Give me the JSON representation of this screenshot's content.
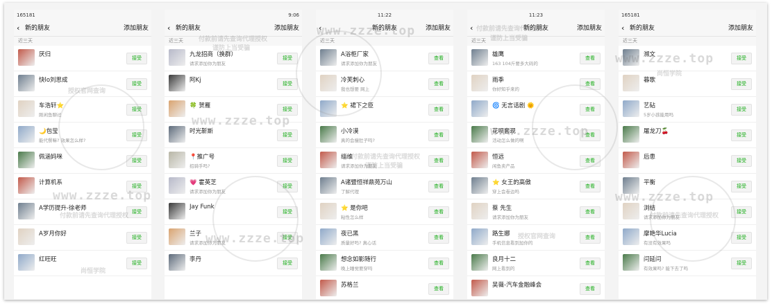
{
  "screens": [
    {
      "status": {
        "left": "165181",
        "center": "",
        "right": ""
      },
      "nav": {
        "title": "新的朋友",
        "add": "添加朋友",
        "centered": false
      },
      "section": "近三天",
      "rows": [
        {
          "name": "厌归",
          "msg": "",
          "btn": "接受"
        },
        {
          "name": "快lo刘思成",
          "msg": "",
          "btn": "接受"
        },
        {
          "name": "车浩轩⭐",
          "msg": "刚闲鱼聊过",
          "btn": "接受"
        },
        {
          "name": "🌙包莹",
          "msg": "能代餐嘛? 效果怎么样?",
          "btn": "接受"
        },
        {
          "name": "佩涵妈咪",
          "msg": "",
          "btn": "接受"
        },
        {
          "name": "计算机系",
          "msg": "",
          "btn": "接受"
        },
        {
          "name": "A学历提升-徐老师",
          "msg": "",
          "btn": "接受"
        },
        {
          "name": "A岁月你好",
          "msg": "",
          "btn": "接受"
        },
        {
          "name": "红旺旺",
          "msg": "",
          "btn": "接受"
        }
      ]
    },
    {
      "status": {
        "left": "",
        "center": "",
        "right": "9:06"
      },
      "nav": {
        "title": "新的朋友",
        "add": "添加朋友",
        "centered": false
      },
      "section": "近三天",
      "rows": [
        {
          "name": "九龙招商（换群）",
          "msg": "请求添加你为朋友",
          "btn": "接受"
        },
        {
          "name": "阿Kj",
          "msg": "",
          "btn": "接受"
        },
        {
          "name": "🍀 贺雁",
          "msg": "",
          "btn": "接受"
        },
        {
          "name": "时光靳斯",
          "msg": "",
          "btn": "接受"
        },
        {
          "name": "📍推广号",
          "msg": "招骑手吗?",
          "btn": "接受"
        },
        {
          "name": "💗 霍英芝",
          "msg": "请求添加你为朋友",
          "btn": "接受"
        },
        {
          "name": "Jay Funk",
          "msg": "",
          "btn": "接受"
        },
        {
          "name": "兰子",
          "msg": "请求添加你为朋友",
          "btn": "接受"
        },
        {
          "name": "李丹",
          "msg": "",
          "btn": "接受"
        }
      ]
    },
    {
      "status": {
        "left": "",
        "center": "11:22",
        "right": ""
      },
      "nav": {
        "title": "新的朋友",
        "add": "添加朋友",
        "centered": true
      },
      "section": "近三天",
      "rows": [
        {
          "name": "A浴柜厂家",
          "msg": "请求添加你为朋友",
          "btn": "查看"
        },
        {
          "name": "冷芙刺心",
          "msg": "我也想要 网上",
          "btn": "查看"
        },
        {
          "name": "⭐ 裙下之臣",
          "msg": "",
          "btn": "查看"
        },
        {
          "name": "小冷漠",
          "msg": "真的会瘦肚子吗?",
          "btn": "查看"
        },
        {
          "name": "缁维",
          "msg": "请求添加你为朋友",
          "btn": "查看"
        },
        {
          "name": "A诸暨恒祥鼎苑万山",
          "msg": "了解代理",
          "btn": "查看"
        },
        {
          "name": "⭐ 是你吧",
          "msg": "粘性怎么样",
          "btn": "查看"
        },
        {
          "name": "夜已黑",
          "msg": "质量好吗? 真心话",
          "btn": "查看"
        },
        {
          "name": "想念如影随行",
          "msg": "晚上睡觉要穿吗",
          "btn": "查看"
        },
        {
          "name": "苏格兰",
          "msg": "",
          "btn": "查看"
        }
      ]
    },
    {
      "status": {
        "left": "",
        "center": "11:23",
        "right": ""
      },
      "nav": {
        "title": "新的朋友",
        "add": "添加朋友",
        "centered": true
      },
      "section": "近三天",
      "rows": [
        {
          "name": "雄鹰",
          "msg": "163  104斤要多大码的",
          "btn": "查看"
        },
        {
          "name": "雨季",
          "msg": "你好知乎来的",
          "btn": "查看"
        },
        {
          "name": "🌀 无言话剧 🌞",
          "msg": "",
          "btn": "查看"
        },
        {
          "name": "花呗套现",
          "msg": "活动怎么做的啊",
          "btn": "查看"
        },
        {
          "name": "恒远",
          "msg": "闲鱼卖产品",
          "btn": "查看"
        },
        {
          "name": "⭐ 女王的高傲",
          "msg": "穿上会卷边吗",
          "btn": "查看"
        },
        {
          "name": "蔡 先生",
          "msg": "请求添加你为朋友",
          "btn": "查看"
        },
        {
          "name": "路生娜",
          "msg": "手机信息看到加你的",
          "btn": "查看"
        },
        {
          "name": "良月十二",
          "msg": "网上看到的",
          "btn": "查看"
        },
        {
          "name": "吴薇-汽车金融峰会",
          "msg": "",
          "btn": "查看"
        }
      ]
    },
    {
      "status": {
        "left": "165181",
        "center": "",
        "right": ""
      },
      "nav": {
        "title": "新的朋友",
        "add": "添加朋友",
        "centered": false
      },
      "section": "近三天",
      "rows": [
        {
          "name": "濒文",
          "msg": "",
          "btn": "接受"
        },
        {
          "name": "暮歌",
          "msg": "",
          "btn": "接受"
        },
        {
          "name": "艺砧",
          "msg": "5岁小孩能用吗",
          "btn": "接受"
        },
        {
          "name": "屠龙刀🍒",
          "msg": "",
          "btn": "接受"
        },
        {
          "name": "后患",
          "msg": "",
          "btn": "接受"
        },
        {
          "name": "平衡",
          "msg": "",
          "btn": "接受"
        },
        {
          "name": "浏结",
          "msg": "请求添加你为朋友",
          "btn": "接受"
        },
        {
          "name": "摩艳华Lucia",
          "msg": "有没有效果吗",
          "btn": "接受"
        },
        {
          "name": "闫延闫",
          "msg": "有效果吗? 能下去了吗",
          "btn": "接受"
        }
      ]
    }
  ],
  "watermark": {
    "url": "www.zzze.top",
    "line1": "尚恒学院",
    "line2": "授权官网查询",
    "line3": "付款前请先查询代理授权",
    "line4": "谨防上当受骗"
  },
  "colors": {
    "accent": "#1aad19",
    "nav_bg": "#f7f7f7",
    "muted": "#999999"
  },
  "avatar_colors": [
    "#c25a4b",
    "#3a3a3a",
    "#8fa9c9",
    "#b8b6a6",
    "#6f7f8f",
    "#d9a36f",
    "#4a7a4a",
    "#b7b9c9",
    "#e0d2c2",
    "#5e6b7b"
  ]
}
